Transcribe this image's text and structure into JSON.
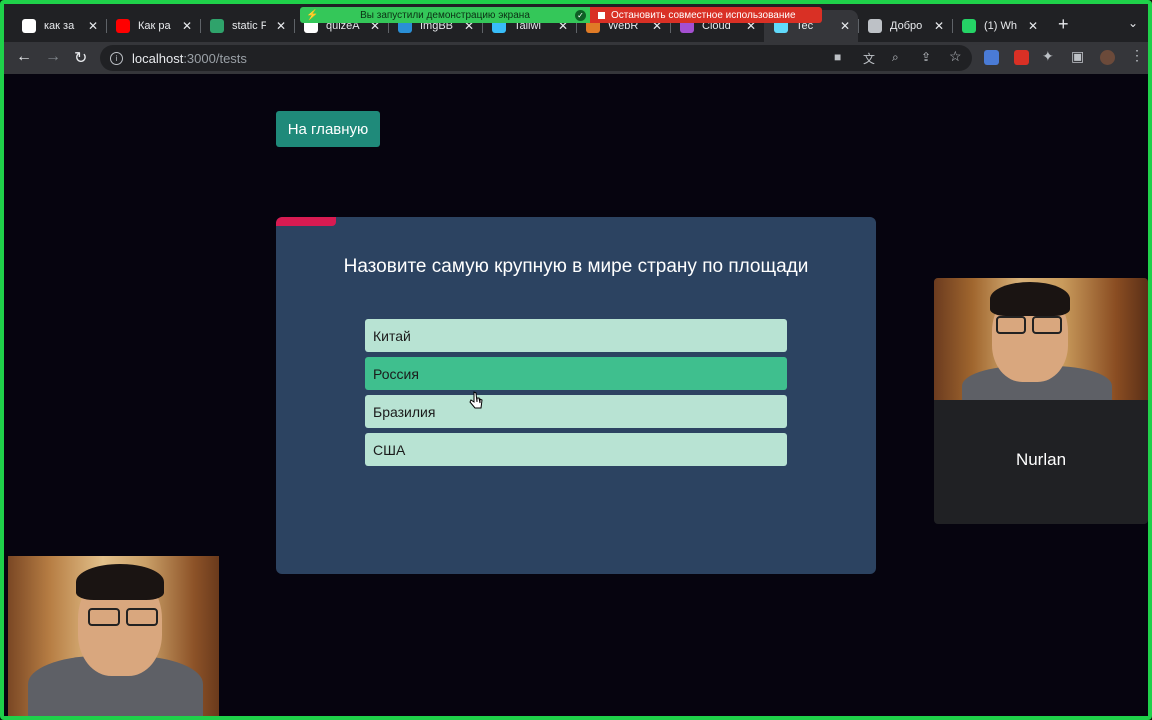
{
  "browser": {
    "tabs": [
      {
        "label": "как за",
        "favicon": "google-icon",
        "color": "#ffffff"
      },
      {
        "label": "Как ра",
        "favicon": "youtube-icon",
        "color": "#ff0000"
      },
      {
        "label": "static F",
        "favicon": "netlify-icon",
        "color": "#2fa36b"
      },
      {
        "label": "quizeA",
        "favicon": "github-icon",
        "color": "#ffffff"
      },
      {
        "label": "ImgBB",
        "favicon": "imgbb-icon",
        "color": "#2a8fd6"
      },
      {
        "label": "Tailwi",
        "favicon": "tailwind-icon",
        "color": "#38bdf8"
      },
      {
        "label": "WebR",
        "favicon": "webrtc-icon",
        "color": "#e07b26"
      },
      {
        "label": "Cloud",
        "favicon": "cloud-icon",
        "color": "#a44fd1"
      },
      {
        "label": "Tec",
        "favicon": "react-icon",
        "color": "#61dafb"
      },
      {
        "label": "Добро",
        "favicon": "globe-icon",
        "color": "#bdc1c6"
      },
      {
        "label": "(1) Wh",
        "favicon": "whatsapp-icon",
        "color": "#25d366"
      }
    ],
    "active_tab_index": 8,
    "new_tab_symbol": "+",
    "url_host": "localhost",
    "url_path": ":3000/tests"
  },
  "share_banner": {
    "message": "Вы запустили демонстрацию экрана",
    "stop_label": "Остановить совместное использование"
  },
  "page": {
    "home_button_label": "На главную",
    "quiz": {
      "question": "Назовите самую крупную в мире страну по площади",
      "answers": [
        "Китай",
        "Россия",
        "Бразилия",
        "США"
      ],
      "highlighted_answer_index": 1,
      "progress_fraction": 0.1,
      "progress_color": "#d81b52"
    }
  },
  "call": {
    "remote_participant_name": "Nurlan"
  },
  "colors": {
    "page_background": "#06040f",
    "card_background": "#2c4361",
    "answer_default": "#b8e3d3",
    "answer_highlight": "#3fbf8e",
    "home_button": "#1f8a7a",
    "frame_border": "#1fd14a"
  }
}
